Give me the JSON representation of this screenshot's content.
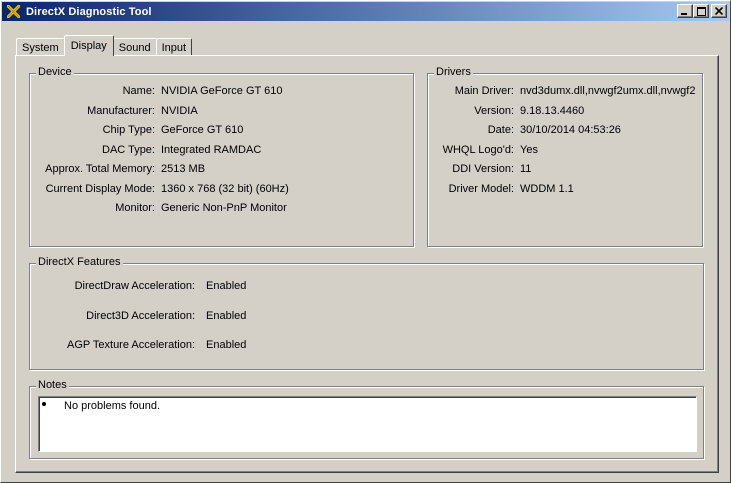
{
  "window": {
    "title": "DirectX Diagnostic Tool",
    "icon": "directx-x-icon"
  },
  "title_buttons": [
    "minimize",
    "maximize",
    "close"
  ],
  "tabs": [
    {
      "label": "System",
      "active": false
    },
    {
      "label": "Display",
      "active": true
    },
    {
      "label": "Sound",
      "active": false
    },
    {
      "label": "Input",
      "active": false
    }
  ],
  "device": {
    "title": "Device",
    "rows": [
      {
        "label": "Name:",
        "value": "NVIDIA GeForce GT 610"
      },
      {
        "label": "Manufacturer:",
        "value": "NVIDIA"
      },
      {
        "label": "Chip Type:",
        "value": "GeForce GT 610"
      },
      {
        "label": "DAC Type:",
        "value": "Integrated RAMDAC"
      },
      {
        "label": "Approx. Total Memory:",
        "value": "2513 MB"
      },
      {
        "label": "Current Display Mode:",
        "value": "1360 x 768 (32 bit) (60Hz)"
      },
      {
        "label": "Monitor:",
        "value": "Generic Non-PnP Monitor"
      }
    ]
  },
  "drivers": {
    "title": "Drivers",
    "rows": [
      {
        "label": "Main Driver:",
        "value": "nvd3dumx.dll,nvwgf2umx.dll,nvwgf2"
      },
      {
        "label": "Version:",
        "value": "9.18.13.4460"
      },
      {
        "label": "Date:",
        "value": "30/10/2014 04:53:26"
      },
      {
        "label": "WHQL Logo'd:",
        "value": "Yes"
      },
      {
        "label": "DDI Version:",
        "value": "11"
      },
      {
        "label": "Driver Model:",
        "value": "WDDM 1.1"
      }
    ]
  },
  "features": {
    "title": "DirectX Features",
    "rows": [
      {
        "label": "DirectDraw Acceleration:",
        "value": "Enabled"
      },
      {
        "label": "Direct3D Acceleration:",
        "value": "Enabled"
      },
      {
        "label": "AGP Texture Acceleration:",
        "value": "Enabled"
      }
    ]
  },
  "notes": {
    "title": "Notes",
    "items": [
      "No problems found."
    ]
  }
}
